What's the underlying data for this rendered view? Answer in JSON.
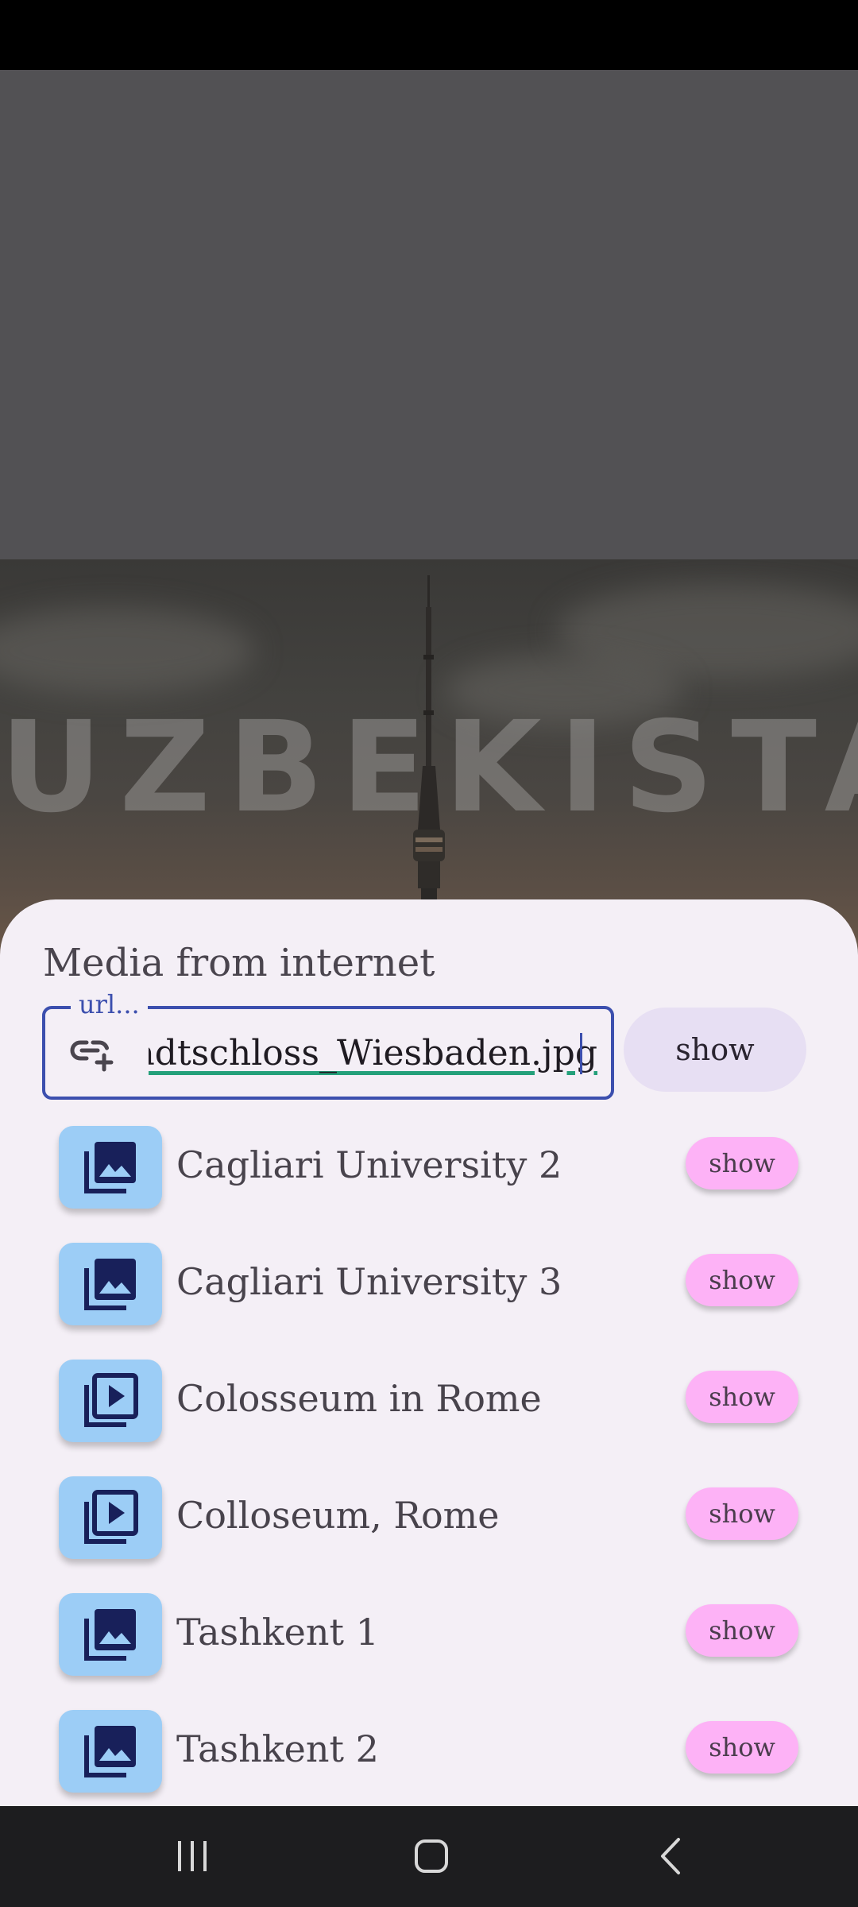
{
  "video": {
    "title_overlay": "UZBEKISTAN"
  },
  "sheet": {
    "title": "Media from internet",
    "url_field": {
      "label": "url...",
      "value": "adtschloss_Wiesbaden.jpg",
      "icon": "add-link-icon"
    },
    "show_button_label": "show"
  },
  "media_items": [
    {
      "label": "Cagliari University 2",
      "icon": "photo-library-icon",
      "button": "show"
    },
    {
      "label": "Cagliari University 3",
      "icon": "photo-library-icon",
      "button": "show"
    },
    {
      "label": "Colosseum in Rome",
      "icon": "video-library-icon",
      "button": "show"
    },
    {
      "label": "Colloseum, Rome",
      "icon": "video-library-icon",
      "button": "show"
    },
    {
      "label": "Tashkent 1",
      "icon": "photo-library-icon",
      "button": "show"
    },
    {
      "label": "Tashkent 2",
      "icon": "photo-library-icon",
      "button": "show"
    }
  ],
  "nav_bar": {
    "items": [
      "recents-icon",
      "home-icon",
      "back-icon"
    ]
  },
  "colors": {
    "accent": "#3c4fae",
    "thumb_bg": "#9ccdf6",
    "item_button_bg": "#fdb2f6",
    "sheet_bg": "#f4eff6",
    "underline": "#24a07a"
  }
}
